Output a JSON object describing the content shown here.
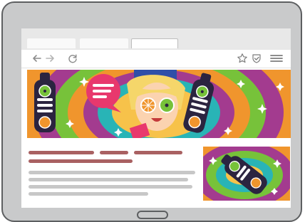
{
  "browser": {
    "tabs": [
      "",
      "",
      ""
    ],
    "toolbar": {
      "back_icon": "arrow-left-icon",
      "forward_icon": "arrow-right-icon",
      "reload_icon": "reload-icon",
      "bookmark_icon": "star-icon",
      "shield_icon": "shield-check-icon",
      "menu_icon": "hamburger-menu-icon"
    }
  },
  "colors": {
    "device_frame": "#c9cacb",
    "device_border": "#5d5f61",
    "title_lines": "#a96162",
    "body_lines": "#c7c7c7",
    "hero_orange": "#f0952d",
    "hero_purple": "#a33b8f",
    "hero_green": "#77c23a",
    "hero_teal": "#29b4b6",
    "bottle_dark": "#2b2440",
    "bubble_pink": "#e8386d"
  }
}
